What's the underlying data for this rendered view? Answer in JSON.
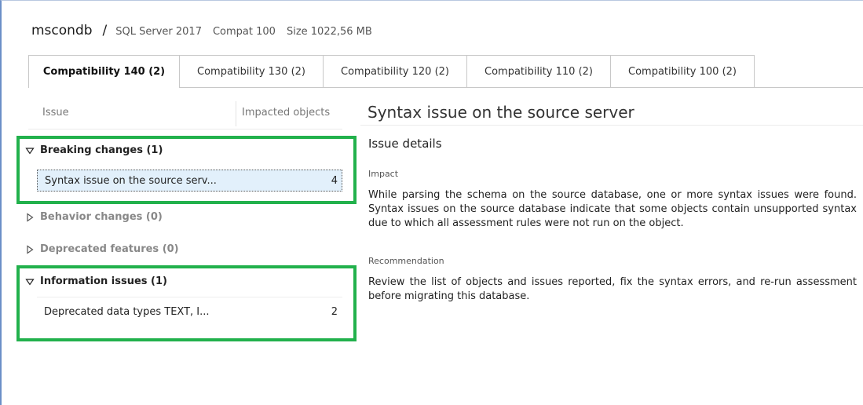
{
  "header": {
    "db_name": "mscondb",
    "separator": "/",
    "server": "SQL Server 2017",
    "compat": "Compat 100",
    "size": "Size 1022,56 MB"
  },
  "tabs": [
    {
      "label": "Compatibility 140 (2)",
      "active": true
    },
    {
      "label": "Compatibility 130 (2)",
      "active": false
    },
    {
      "label": "Compatibility 120 (2)",
      "active": false
    },
    {
      "label": "Compatibility 110 (2)",
      "active": false
    },
    {
      "label": "Compatibility 100 (2)",
      "active": false
    }
  ],
  "issues_panel": {
    "col_issue": "Issue",
    "col_impacted": "Impacted objects",
    "groups": [
      {
        "label": "Breaking changes (1)",
        "expanded": true,
        "items": [
          {
            "label": "Syntax issue on the source serv...",
            "count": "4",
            "selected": true
          }
        ]
      },
      {
        "label": "Behavior changes (0)",
        "expanded": false,
        "items": []
      },
      {
        "label": "Deprecated features (0)",
        "expanded": false,
        "items": []
      },
      {
        "label": "Information issues (1)",
        "expanded": true,
        "items": [
          {
            "label": "Deprecated data types TEXT, I...",
            "count": "2",
            "selected": false
          }
        ]
      }
    ]
  },
  "detail": {
    "title": "Syntax issue on the source server",
    "section": "Issue details",
    "impact_label": "Impact",
    "impact_text": "While parsing the schema on the source database, one or more syntax issues were found. Syntax issues on the source database indicate that some objects contain unsupported syntax due to which all assessment rules were not run on the object.",
    "recommendation_label": "Recommendation",
    "recommendation_text": "Review the list of objects and issues reported, fix the syntax errors, and re-run assessment before migrating this database."
  },
  "colors": {
    "highlight_border": "#22b14c",
    "selected_row": "#e2f0fb",
    "window_border": "#6b8fc7"
  }
}
